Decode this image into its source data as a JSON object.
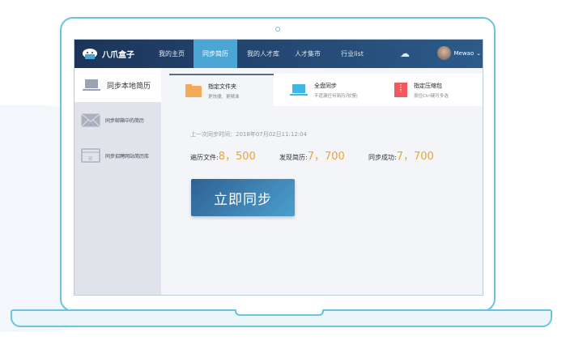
{
  "app": {
    "name": "八爪盒子"
  },
  "nav": {
    "items": [
      "我的主页",
      "同步简历",
      "我的人才库",
      "人才集市",
      "行业list"
    ],
    "active": 1,
    "user": "Mewao"
  },
  "sidebar": {
    "items": [
      "同步本地简历",
      "同步邮箱中的简历",
      "同步招聘网站简历库"
    ]
  },
  "tabs": [
    {
      "title": "指定文件夹",
      "sub": "更快捷、更精准"
    },
    {
      "title": "全盘同步",
      "sub": "不遗漏任何简历(较慢)"
    },
    {
      "title": "指定压缩包",
      "sub": "按住Ctrl键可多选"
    }
  ],
  "main": {
    "last_sync": "上一次同步时间：2018年07月02日11:12:04",
    "stats": [
      {
        "label": "遍历文件:",
        "value": "8，500"
      },
      {
        "label": "发现简历:",
        "value": "7，700"
      },
      {
        "label": "同步成功:",
        "value": "7，700"
      }
    ],
    "sync_button": "立即同步"
  },
  "colors": {
    "nav": "#1c3459",
    "active": "#4ba6d6",
    "accent": "#f0a32e"
  }
}
